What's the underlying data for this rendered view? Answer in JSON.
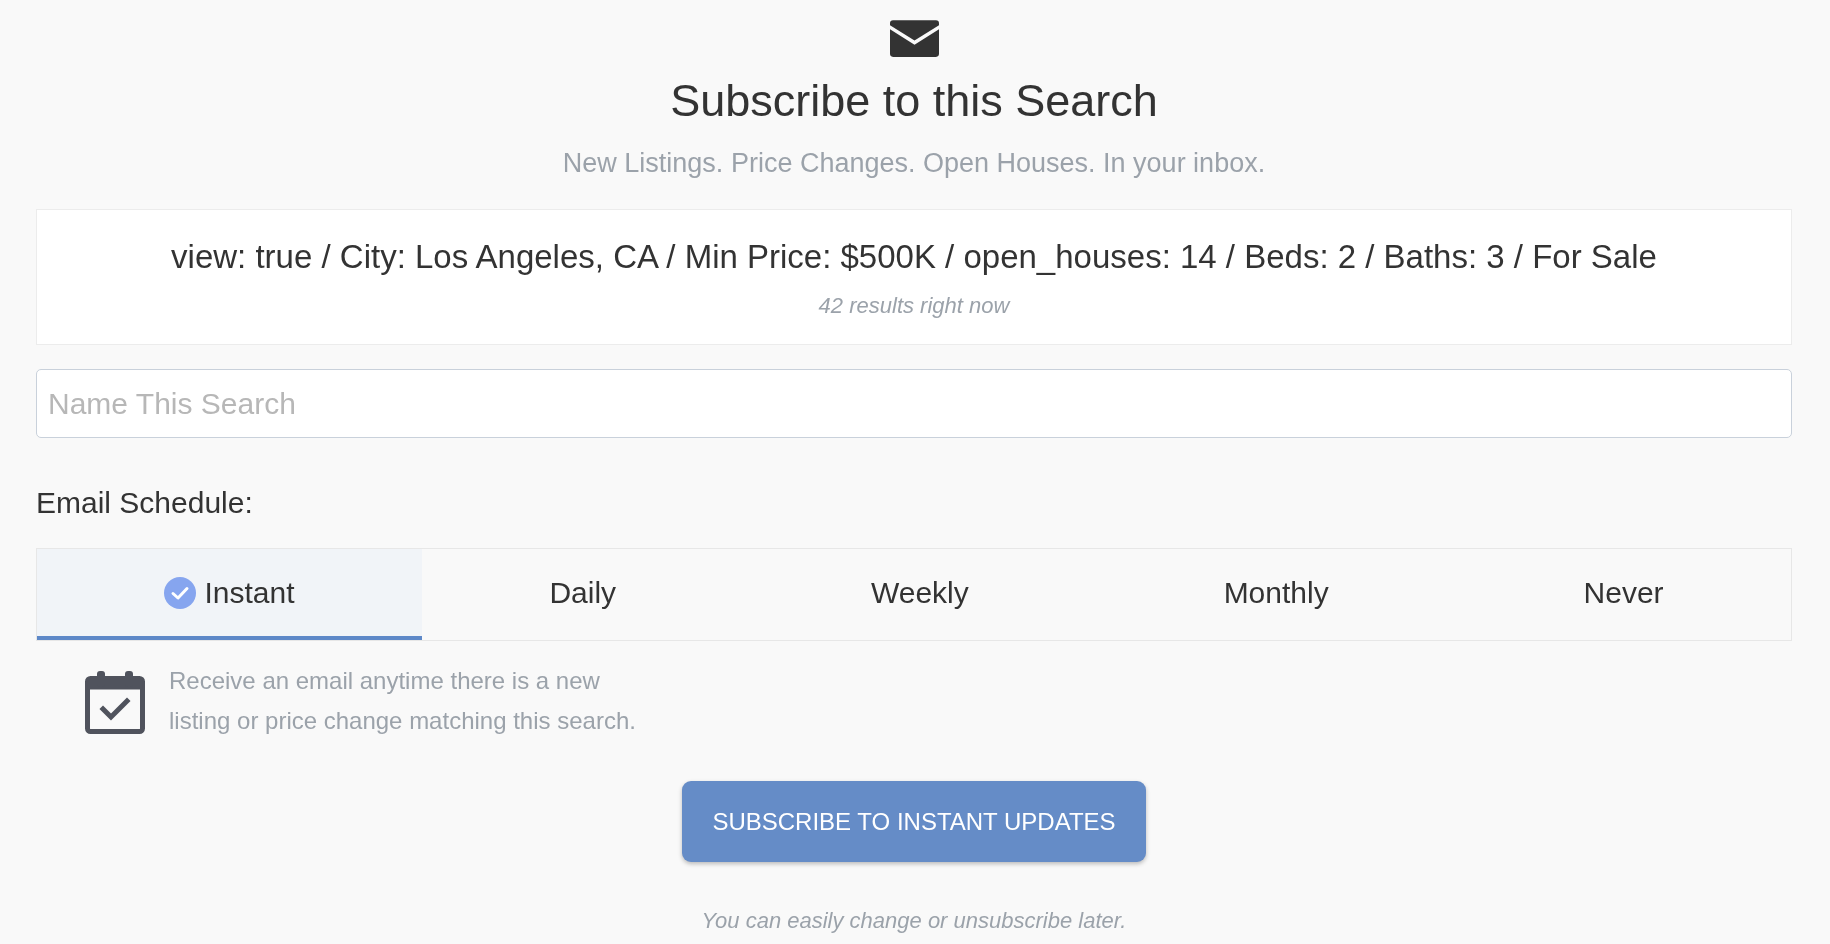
{
  "header": {
    "title": "Subscribe to this Search",
    "subtitle": "New Listings. Price Changes. Open Houses. In your inbox."
  },
  "search_summary": {
    "criteria": "view: true / City: Los Angeles, CA / Min Price: $500K / open_houses: 14 / Beds: 2 / Baths: 3 / For Sale",
    "result_count": "42 results right now"
  },
  "name_field": {
    "placeholder": "Name This Search"
  },
  "schedule": {
    "label": "Email Schedule:",
    "tabs": [
      {
        "label": "Instant",
        "selected": true
      },
      {
        "label": "Daily",
        "selected": false
      },
      {
        "label": "Weekly",
        "selected": false
      },
      {
        "label": "Monthly",
        "selected": false
      },
      {
        "label": "Never",
        "selected": false
      }
    ],
    "description": "Receive an email anytime there is a new listing or price change matching this search."
  },
  "subscribe_button": {
    "label": "SUBSCRIBE TO INSTANT UPDATES"
  },
  "footnote": "You can easily change or unsubscribe later."
}
